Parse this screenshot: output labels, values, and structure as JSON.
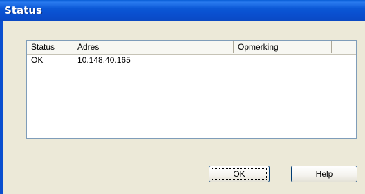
{
  "window": {
    "title": "Status"
  },
  "list": {
    "columns": [
      "Status",
      "Adres",
      "Opmerking"
    ],
    "rows": [
      {
        "status": "OK",
        "adres": "10.148.40.165",
        "opmerking": ""
      }
    ]
  },
  "buttons": {
    "ok_label": "OK",
    "help_label": "Help"
  }
}
